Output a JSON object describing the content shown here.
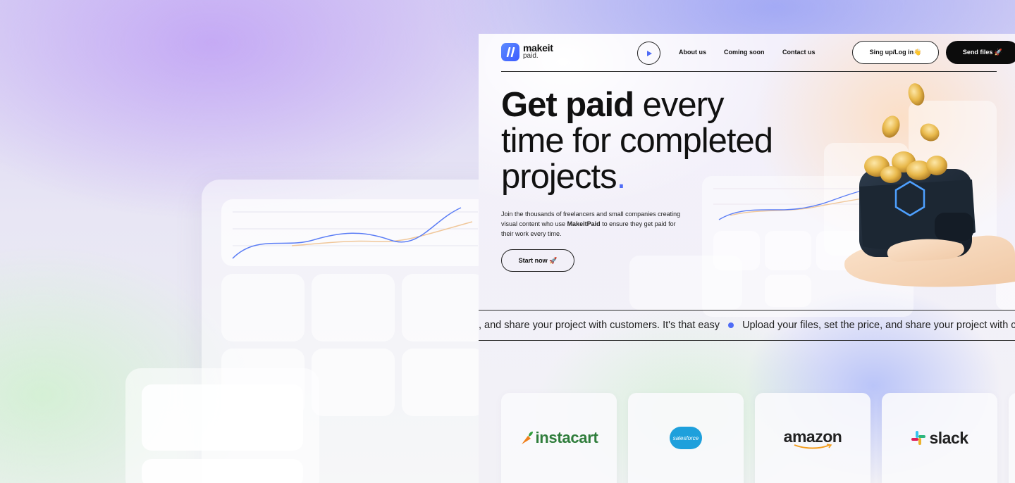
{
  "nav": {
    "logo_name": "makeit",
    "logo_sub": "paid.",
    "links": [
      "About us",
      "Coming soon",
      "Contact us"
    ],
    "signup_label": "Sing up/Log in👋",
    "send_label": "Send files 🚀"
  },
  "hero": {
    "title_bold": "Get paid",
    "title_rest1": " every",
    "title_line2": "time for completed",
    "title_line3": "projects",
    "title_dot": ".",
    "desc_part1": "Join the thousands of freelancers and small companies creating visual content who use ",
    "desc_brand": "MakeitPaid",
    "desc_part2": " to ensure they get paid for their work every time.",
    "start_label": "Start now 🚀"
  },
  "marquee": {
    "text1": ", and share your project with customers. It's that easy",
    "text2": "Upload your files, set the price, and share your project with customers. It's that easy"
  },
  "brands": {
    "instacart": "instacart",
    "salesforce": "salesforce",
    "amazon": "amazon",
    "slack": "slack"
  },
  "colors": {
    "accent": "#4f6cf6",
    "dark": "#0c0c0c",
    "coin": "#e8b84a",
    "wallet": "#1f2a36"
  }
}
